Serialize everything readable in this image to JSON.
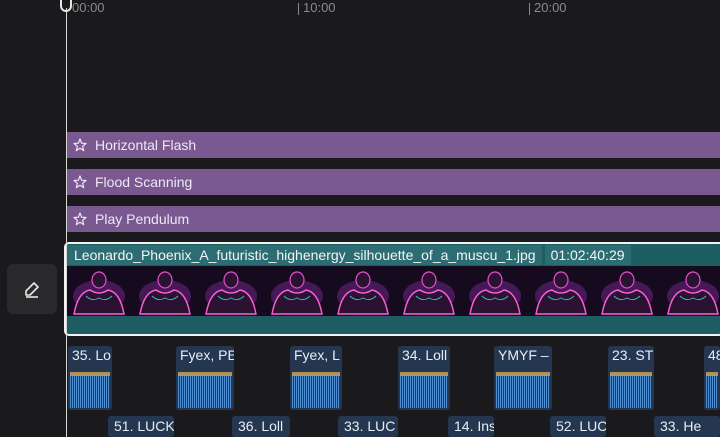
{
  "ruler": {
    "labels": [
      "00:00",
      "10:00",
      "20:00"
    ]
  },
  "effect_tracks": [
    {
      "label": "Horizontal Flash",
      "icon": "sparkle-icon"
    },
    {
      "label": "Flood Scanning",
      "icon": "sparkle-icon"
    },
    {
      "label": "Play Pendulum",
      "icon": "sparkle-icon"
    }
  ],
  "video_clip": {
    "filename": "Leonardo_Phoenix_A_futuristic_highenergy_silhouette_of_a_muscu_1.jpg",
    "duration": "01:02:40:29"
  },
  "audio_row1": [
    {
      "label": "35. Lo"
    },
    {
      "label": "Fyex, PE"
    },
    {
      "label": "Fyex, L"
    },
    {
      "label": "34. Loll"
    },
    {
      "label": "YMYF –"
    },
    {
      "label": "23. ST"
    },
    {
      "label": "48"
    }
  ],
  "audio_row2": [
    {
      "label": "51. LUCK"
    },
    {
      "label": "36. Loll"
    },
    {
      "label": "33. LUC"
    },
    {
      "label": "14. Ins"
    },
    {
      "label": "52. LUC"
    },
    {
      "label": "33. He"
    }
  ],
  "colors": {
    "background": "#1a1a1c",
    "effect_track": "#7a5990",
    "video_clip": "#1e5e63",
    "audio_clip": "#243650",
    "waveform": "#4f8fcf"
  }
}
